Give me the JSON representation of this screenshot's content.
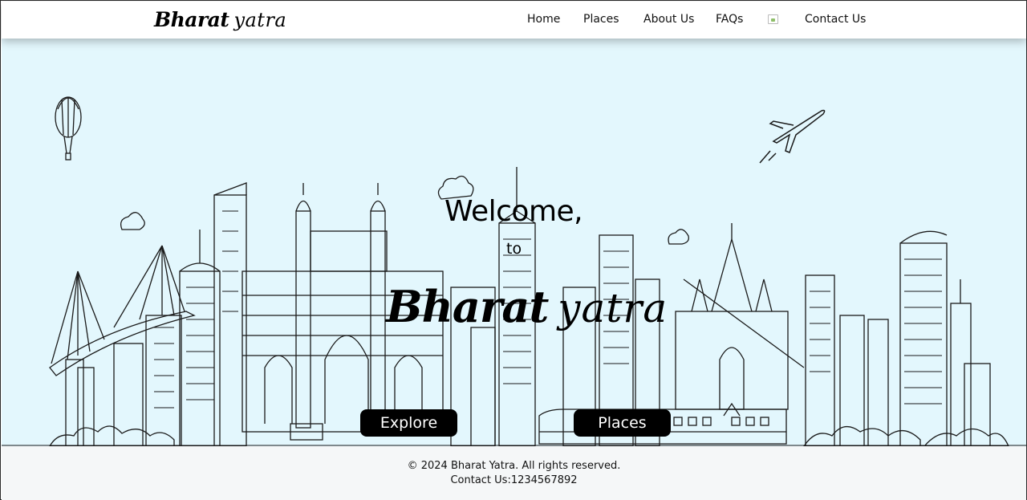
{
  "header": {
    "logo_part1": "Bharat",
    "logo_part2": "yatra",
    "nav": [
      {
        "label": "Home"
      },
      {
        "label": "Places"
      },
      {
        "label": "About Us"
      },
      {
        "label": "FAQs"
      },
      {
        "label": "Contact Us"
      }
    ],
    "broken_image_icon": "broken-image-icon"
  },
  "hero": {
    "welcome": "Welcome,",
    "to": "to",
    "title_part1": "Bharat",
    "title_part2": "yatra",
    "buttons": {
      "explore": "Explore",
      "places": "Places"
    },
    "background_color": "#e3f7fd"
  },
  "footer": {
    "copyright": "© 2024 Bharat Yatra. All rights reserved.",
    "contact": "Contact Us:1234567892"
  },
  "colors": {
    "button_bg": "#000000",
    "button_text": "#ffffff",
    "footer_bg": "#f5f7f8"
  }
}
